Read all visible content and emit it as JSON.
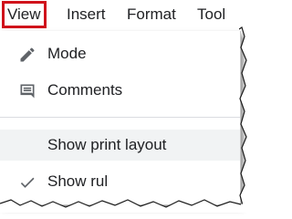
{
  "menubar": {
    "items": [
      {
        "label": "View",
        "active": true
      },
      {
        "label": "Insert"
      },
      {
        "label": "Format"
      },
      {
        "label": "Tool"
      }
    ]
  },
  "dropdown": {
    "items": [
      {
        "label": "Mode",
        "icon": "pencil-icon"
      },
      {
        "label": "Comments",
        "icon": "comment-icon"
      },
      {
        "label": "Show print layout",
        "highlighted": true
      },
      {
        "label": "Show rul",
        "icon": "checkmark-icon"
      }
    ]
  },
  "colors": {
    "active_outline": "#d0121b",
    "text": "#202124",
    "highlight_bg": "#f1f3f4",
    "icon": "#5f6368"
  }
}
